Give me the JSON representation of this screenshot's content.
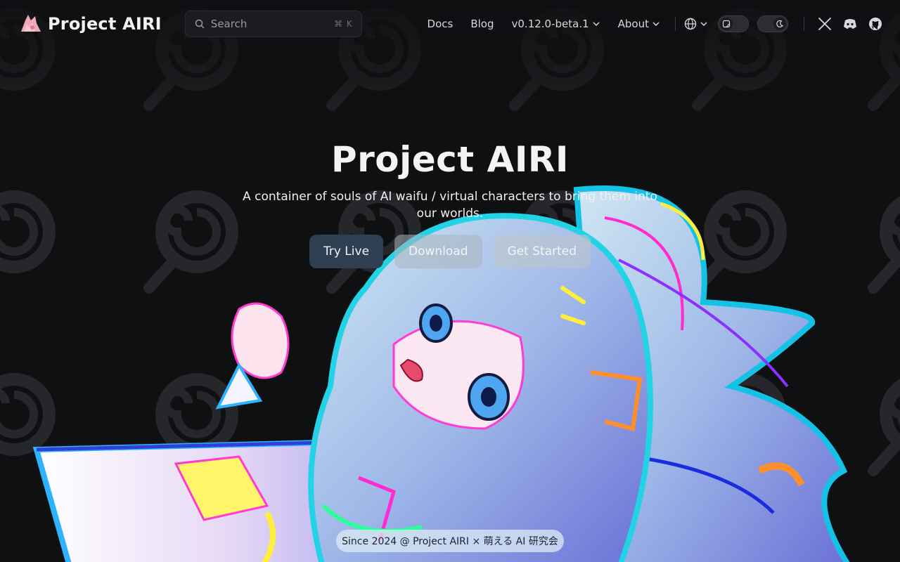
{
  "header": {
    "brand_title": "Project AIRI",
    "search": {
      "placeholder": "Search",
      "shortcut": "⌘ K"
    },
    "nav": {
      "docs": "Docs",
      "blog": "Blog",
      "version": "v0.12.0-beta.1",
      "about": "About"
    },
    "icons": {
      "language": "globe-icon",
      "toggle_1": "sticker-toggle-icon",
      "toggle_2": "theme-toggle-icon",
      "x": "x-icon",
      "discord": "discord-icon",
      "github": "github-icon"
    }
  },
  "hero": {
    "title": "Project AIRI",
    "subtitle": "A container of souls of AI waifu / virtual characters to bring them into our worlds.",
    "buttons": {
      "try_live": "Try Live",
      "download": "Download",
      "get_started": "Get Started"
    }
  },
  "footer": {
    "note": "Since 2024 @ Project AIRI × 萌える AI 研究会"
  },
  "colors": {
    "background": "#0f1012",
    "primary_button": "#2f3f52",
    "text": "#f2f2f2"
  }
}
